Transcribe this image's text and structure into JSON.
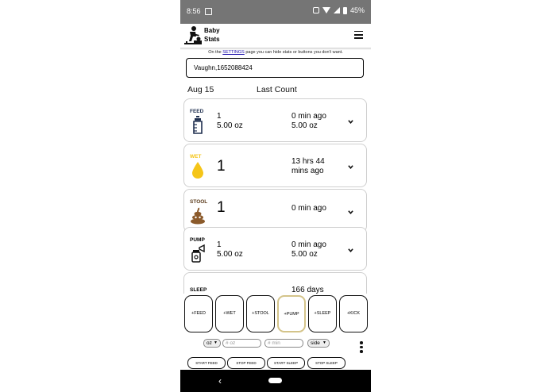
{
  "status_bar": {
    "time": "8:56",
    "battery": "45%"
  },
  "header": {
    "title_line1": "Baby",
    "title_line2": "Stats",
    "logo_icon": "parent-changing-baby-icon",
    "menu_icon": "hamburger-menu-icon"
  },
  "note": {
    "prefix": "On the ",
    "link": "SETTINGS",
    "suffix": " page you can hide stats or buttons you don't want."
  },
  "name_field": {
    "value": "Vaughn,1652088424"
  },
  "summary": {
    "date": "Aug 15",
    "column_label": "Last Count"
  },
  "cards": [
    {
      "label": "FEED",
      "icon": "baby-bottle-icon",
      "count": "1",
      "amount": "5.00 oz",
      "ago_line1": "0 min ago",
      "ago_line2": "5.00 oz"
    },
    {
      "label": "WET",
      "icon": "water-drop-icon",
      "count": "1",
      "amount": "",
      "ago_line1": "13 hrs 44",
      "ago_line2": "mins ago"
    },
    {
      "label": "STOOL",
      "icon": "poop-icon",
      "count": "1",
      "amount": "",
      "ago_line1": "0 min ago",
      "ago_line2": ""
    },
    {
      "label": "PUMP",
      "icon": "breast-pump-icon",
      "count": "1",
      "amount": "5.00 oz",
      "ago_line1": "0 min ago",
      "ago_line2": "5.00 oz"
    },
    {
      "label": "SLEEP",
      "icon": "sleep-icon",
      "count": "",
      "amount": "",
      "ago_line1": "166 days",
      "ago_line2": ""
    }
  ],
  "actions": {
    "buttons": [
      "+FEED",
      "+WET",
      "+STOOL",
      "+PUMP",
      "+SLEEP",
      "+KICK"
    ],
    "unit_select": "oz",
    "amount_placeholder": "# oz",
    "minutes_placeholder": "# min",
    "side_select": "side",
    "small_buttons": [
      "START FEED",
      "STOP FEED",
      "START SLEEP",
      "STOP SLEEP"
    ]
  },
  "colors": {
    "wet_drop": "#f5c518",
    "poop": "#8b5a2b",
    "feed_label": "#1f2f4f",
    "selected_border": "#d4c48a"
  }
}
